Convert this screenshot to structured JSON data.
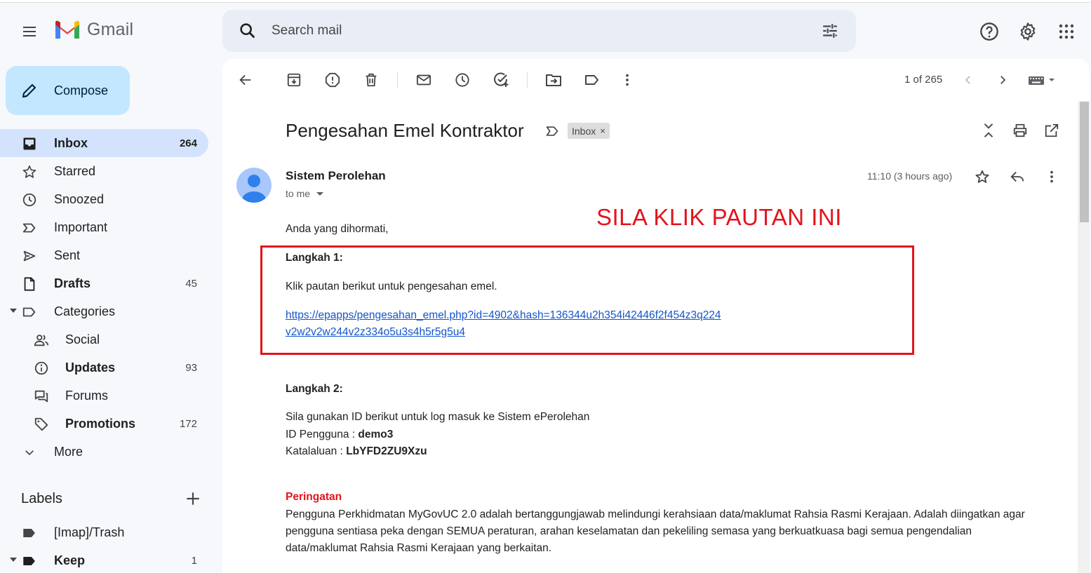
{
  "app": {
    "name": "Gmail"
  },
  "search": {
    "placeholder": "Search mail"
  },
  "compose": {
    "label": "Compose"
  },
  "sidebar": {
    "items": [
      {
        "label": "Inbox",
        "count": "264"
      },
      {
        "label": "Starred",
        "count": ""
      },
      {
        "label": "Snoozed",
        "count": ""
      },
      {
        "label": "Important",
        "count": ""
      },
      {
        "label": "Sent",
        "count": ""
      },
      {
        "label": "Drafts",
        "count": "45"
      },
      {
        "label": "Categories",
        "count": ""
      },
      {
        "label": "Social",
        "count": ""
      },
      {
        "label": "Updates",
        "count": "93"
      },
      {
        "label": "Forums",
        "count": ""
      },
      {
        "label": "Promotions",
        "count": "172"
      },
      {
        "label": "More",
        "count": ""
      }
    ],
    "labels_header": "Labels",
    "labels": [
      {
        "label": "[Imap]/Trash",
        "count": ""
      },
      {
        "label": "Keep",
        "count": "1"
      }
    ]
  },
  "toolbar": {
    "pager": "1 of 265"
  },
  "email": {
    "subject": "Pengesahan Emel Kontraktor",
    "chip": "Inbox",
    "chip_close": "×",
    "sender": "Sistem Perolehan",
    "to": "to me",
    "time": "11:10 (3 hours ago)",
    "greeting": "Anda yang dihormati,",
    "step1_title": "Langkah 1:",
    "step1_text": "Klik pautan berikut untuk pengesahan emel.",
    "link_line1": "https://epapps/pengesahan_emel.php?id=4902&hash=136344u2h354i42446f2f454z3q224",
    "link_line2": "v2w2v2w244v2z334o5u3s4h5r5g5u4",
    "step2_title": "Langkah 2:",
    "step2_text": "Sila gunakan ID berikut untuk log masuk ke Sistem ePerolehan",
    "id_label": "ID Pengguna : ",
    "id_value": "demo3",
    "pw_label": "Katalaluan : ",
    "pw_value": "LbYFD2ZU9Xzu",
    "warning_title": "Peringatan",
    "warning_line1": "Pengguna Perkhidmatan MyGovUC 2.0 adalah bertanggungjawab melindungi kerahsiaan data/maklumat Rahsia Rasmi Kerajaan. Adalah diingatkan agar",
    "warning_line2": "pengguna sentiasa peka dengan SEMUA peraturan, arahan keselamatan dan pekeliling semasa yang berkuatkuasa bagi semua pengendalian",
    "warning_line3": "data/maklumat Rahsia Rasmi Kerajaan yang berkaitan."
  },
  "annotation": {
    "text": "SILA KLIK PAUTAN INI",
    "color": "#e3141c"
  },
  "colors": {
    "compose_bg": "#c2e7ff",
    "active_nav": "#d3e3fd",
    "link": "#1155cc"
  }
}
